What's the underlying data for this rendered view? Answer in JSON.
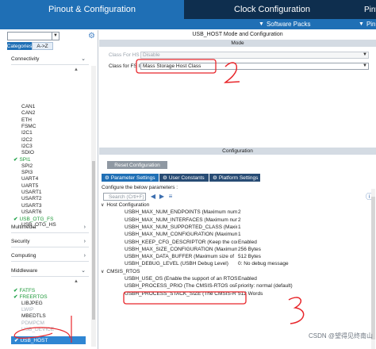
{
  "tabs": {
    "pinout": "Pinout & Configuration",
    "clock": "Clock Configuration",
    "pinv_partial": "Pinv"
  },
  "subbar": {
    "software_packs": "Software Packs",
    "pinout_partial": "Pin"
  },
  "left": {
    "filter_tabs": [
      "Categories",
      "A->Z"
    ],
    "connectivity": "Connectivity",
    "connectivity_items": [
      {
        "label": "CAN1",
        "enabled": false
      },
      {
        "label": "CAN2",
        "enabled": false
      },
      {
        "label": "ETH",
        "enabled": false
      },
      {
        "label": "FSMC",
        "enabled": false
      },
      {
        "label": "I2C1",
        "enabled": false
      },
      {
        "label": "I2C2",
        "enabled": false
      },
      {
        "label": "I2C3",
        "enabled": false
      },
      {
        "label": "SDIO",
        "enabled": false
      },
      {
        "label": "SPI1",
        "enabled": true
      },
      {
        "label": "SPI2",
        "enabled": false
      },
      {
        "label": "SPI3",
        "enabled": false
      },
      {
        "label": "UART4",
        "enabled": false
      },
      {
        "label": "UART5",
        "enabled": false
      },
      {
        "label": "USART1",
        "enabled": false
      },
      {
        "label": "USART2",
        "enabled": false
      },
      {
        "label": "USART3",
        "enabled": false
      },
      {
        "label": "USART6",
        "enabled": false
      },
      {
        "label": "USB_OTG_FS",
        "enabled": true
      },
      {
        "label": "USB_OTG_HS",
        "enabled": false
      }
    ],
    "sections": [
      "Multimedia",
      "Security",
      "Computing",
      "Middleware"
    ],
    "middleware_items": [
      {
        "label": "FATFS",
        "state": "enabled"
      },
      {
        "label": "FREERTOS",
        "state": "enabled"
      },
      {
        "label": "LIBJPEG",
        "state": "normal"
      },
      {
        "label": "LWIP",
        "state": "disabled"
      },
      {
        "label": "MBEDTLS",
        "state": "normal"
      },
      {
        "label": "PDMPCM",
        "state": "disabled"
      },
      {
        "label": "USB_DEVICE",
        "state": "disabled"
      }
    ],
    "selected_item": "USB_HOST"
  },
  "right": {
    "mode_title": "USB_HOST Mode and Configuration",
    "mode_bar": "Mode",
    "class_hs_label": "Class For HS IP",
    "class_hs_value": "Disable",
    "class_fs_label": "Class for FS IP",
    "class_fs_value": "Mass Storage Host Class",
    "configuration_bar": "Configuration",
    "reset_button": "Reset Configuration",
    "param_tabs": [
      "Parameter Settings",
      "User Constants",
      "Platform Settings"
    ],
    "configure_text": "Configure the below parameters :",
    "search_placeholder": "Search (Crtl+F)",
    "groups": [
      {
        "title": "Host Configuration",
        "params": [
          {
            "name": "USBH_MAX_NUM_ENDPOINTS (Maximum num",
            "value": "2"
          },
          {
            "name": "USBH_MAX_NUM_INTERFACES (Maximum num",
            "value": "2"
          },
          {
            "name": "USBH_MAX_NUM_SUPPORTED_CLASS (Maximu",
            "value": "1"
          },
          {
            "name": "USBH_MAX_NUM_CONFIGURATION (Maximum n",
            "value": "1"
          },
          {
            "name": "USBH_KEEP_CFG_DESCRIPTOR (Keep the con",
            "value": "Enabled"
          },
          {
            "name": "USBH_MAX_SIZE_CONFIGURATION (Maximum si",
            "value": "256 Bytes"
          },
          {
            "name": "USBH_MAX_DATA_BUFFER (Maximum size of",
            "value": "512 Bytes"
          },
          {
            "name": "USBH_DEBUG_LEVEL (USBH Debug Level)",
            "value": "0: No debug message"
          }
        ]
      },
      {
        "title": "CMSIS_RTOS",
        "params": [
          {
            "name": "USBH_USE_OS (Enable the support of an RTOS)",
            "value": "Enabled"
          },
          {
            "name": "USBH_PROCESS_PRIO (The CMSIS-RTOS osP",
            "value": "priority: normal (default)"
          },
          {
            "name": "USBH_PROCESS_STACK_SIZE (The CMSIS-RT",
            "value": "512 Words"
          }
        ]
      }
    ]
  },
  "watermark": "CSDN @望得见终南山",
  "annotations": {
    "color": "#e8262b",
    "labels": [
      "2",
      "3"
    ]
  }
}
